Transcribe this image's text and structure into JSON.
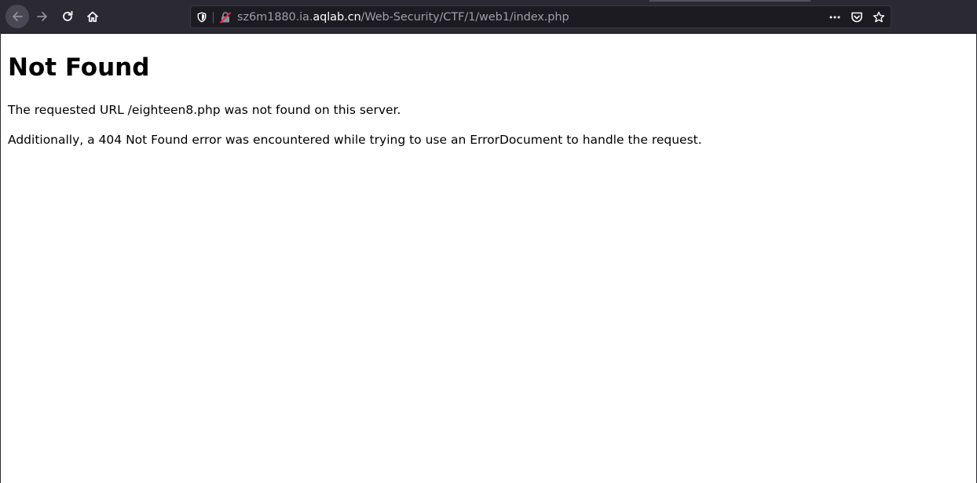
{
  "browser": {
    "toolbar": {
      "back": {
        "icon": "back-arrow-icon"
      },
      "forward": {
        "icon": "forward-arrow-icon"
      },
      "reload": {
        "icon": "reload-icon"
      },
      "home": {
        "icon": "home-icon"
      }
    },
    "urlbar": {
      "url_prefix": "sz6m1880.ia.",
      "url_domain": "aqlab.cn",
      "url_path": "/Web-Security/CTF/1/web1/index.php",
      "icons": [
        "shield-icon",
        "insecure-lock-icon",
        "more-icon",
        "pocket-icon",
        "bookmark-star-icon"
      ]
    },
    "colors": {
      "toolbar_bg": "#2b2a33",
      "urlbar_bg": "#1c1b22",
      "url_text_dim": "#9e9ea6",
      "url_text_host": "#fbfbfe",
      "insecure_lock": "#e22850"
    }
  },
  "page": {
    "heading": "Not Found",
    "message_1": "The requested URL /eighteen8.php was not found on this server.",
    "message_2": "Additionally, a 404 Not Found error was encountered while trying to use an ErrorDocument to handle the request."
  }
}
